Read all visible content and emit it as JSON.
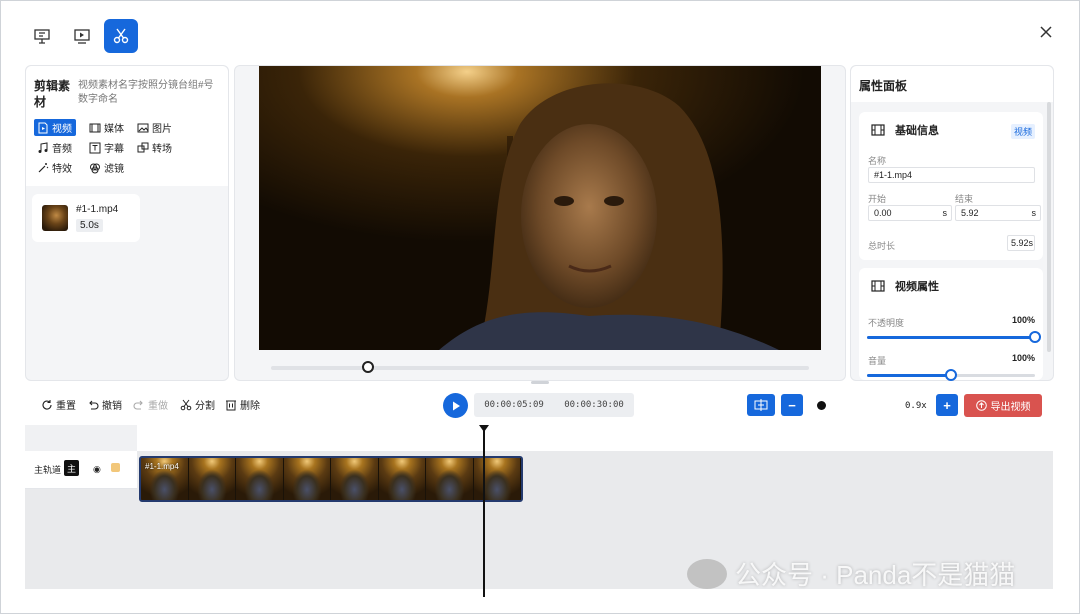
{
  "toolbar": {
    "tabs": [
      {
        "name": "presentation-icon"
      },
      {
        "name": "video-preview-icon"
      },
      {
        "name": "scissors-icon",
        "active": true
      }
    ],
    "close_icon": "close-icon"
  },
  "left": {
    "title": "剪辑素材",
    "subtitle": "视频素材名字按照分镜台组#号数字命名",
    "categories": [
      "视频",
      "媒体",
      "图片",
      "音频",
      "字幕",
      "转场",
      "特效",
      "滤镜"
    ],
    "selected_category": "视频",
    "clip": {
      "name": "#1-1.mp4",
      "duration": "5.0s"
    }
  },
  "preview": {
    "progress": 0.18
  },
  "right": {
    "title": "属性面板",
    "basic": {
      "title": "基础信息",
      "badge": "视频",
      "name_label": "名称",
      "name_value": "#1-1.mp4",
      "start_label": "开始",
      "start_value": "0.00",
      "start_unit": "s",
      "end_label": "结束",
      "end_value": "5.92",
      "end_unit": "s",
      "total_label": "总时长",
      "total_value": "5.92s"
    },
    "video": {
      "title": "视频属性",
      "opacity_label": "不透明度",
      "opacity_value": "100%",
      "opacity_level": 1.0,
      "volume_label": "音量",
      "volume_value": "100%",
      "volume_level": 0.5
    }
  },
  "timeline": {
    "reset": "重置",
    "undo": "撤销",
    "redo": "重做",
    "split": "分割",
    "delete": "删除",
    "current_time": "00:00:05:09",
    "total_time": "00:00:30:00",
    "zoom_minus": "−",
    "zoom_plus": "+",
    "zoom": "0.9x",
    "export": "导出视频",
    "track_name": "主轨道",
    "track_badge": "主",
    "clip_label": "#1-1.mp4"
  },
  "watermark": "公众号 · Panda不是猫猫",
  "colors": {
    "accent": "#1668dc",
    "export": "#d9534f"
  }
}
